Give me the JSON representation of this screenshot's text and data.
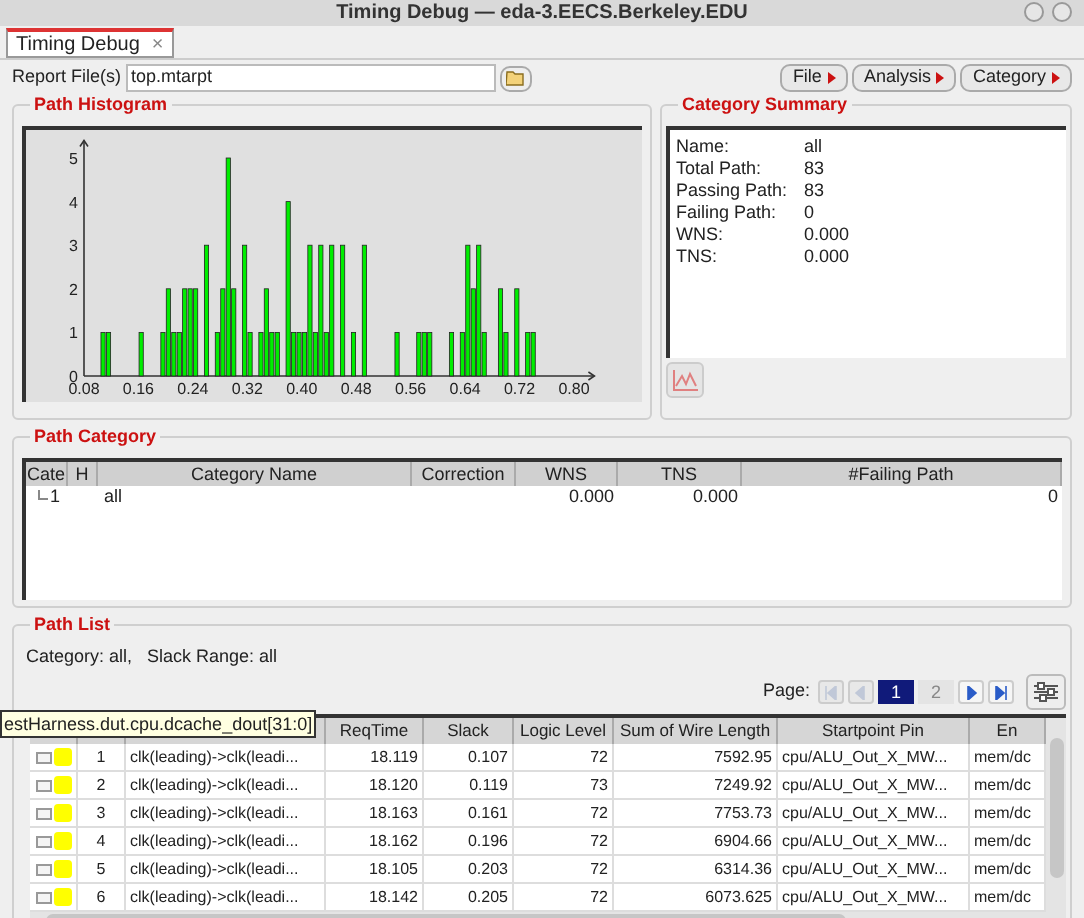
{
  "window": {
    "title": "Timing Debug — eda-3.EECS.Berkeley.EDU"
  },
  "tabs": [
    {
      "label": "Timing Debug",
      "selected": true,
      "close": "×"
    }
  ],
  "report_file": {
    "label": "Report File(s)",
    "value": "top.mtarpt"
  },
  "menu_buttons": [
    "File",
    "Analysis",
    "Category"
  ],
  "path_histogram": {
    "title": "Path Histogram",
    "chart_data": {
      "type": "bar",
      "x": [
        0.108,
        0.116,
        0.164,
        0.196,
        0.204,
        0.212,
        0.22,
        0.228,
        0.236,
        0.244,
        0.26,
        0.276,
        0.284,
        0.292,
        0.3,
        0.316,
        0.324,
        0.34,
        0.348,
        0.356,
        0.364,
        0.38,
        0.388,
        0.396,
        0.404,
        0.412,
        0.42,
        0.428,
        0.436,
        0.444,
        0.46,
        0.476,
        0.492,
        0.54,
        0.572,
        0.58,
        0.588,
        0.62,
        0.636,
        0.644,
        0.652,
        0.66,
        0.668,
        0.692,
        0.7,
        0.716,
        0.732,
        0.74
      ],
      "values": [
        1,
        1,
        1,
        1,
        2,
        1,
        1,
        2,
        2,
        2,
        3,
        1,
        2,
        5,
        2,
        3,
        1,
        1,
        2,
        1,
        1,
        4,
        1,
        1,
        1,
        3,
        1,
        3,
        1,
        3,
        3,
        1,
        3,
        1,
        1,
        1,
        1,
        1,
        1,
        3,
        2,
        3,
        1,
        2,
        1,
        2,
        1,
        1
      ],
      "xlim": [
        0.08,
        0.83
      ],
      "ylim": [
        0,
        5.4
      ],
      "xticks": [
        {
          "value": 0.08,
          "label": "0.08"
        },
        {
          "value": 0.16,
          "label": "0.16"
        },
        {
          "value": 0.24,
          "label": "0.24"
        },
        {
          "value": 0.32,
          "label": "0.32"
        },
        {
          "value": 0.4,
          "label": "0.40"
        },
        {
          "value": 0.48,
          "label": "0.48"
        },
        {
          "value": 0.56,
          "label": "0.56"
        },
        {
          "value": 0.64,
          "label": "0.64"
        },
        {
          "value": 0.72,
          "label": "0.72"
        },
        {
          "value": 0.8,
          "label": "0.80"
        }
      ],
      "yticks": [
        0,
        1,
        2,
        3,
        4,
        5
      ]
    }
  },
  "category_summary": {
    "title": "Category Summary",
    "fields": [
      {
        "label": "Name:",
        "value": "all"
      },
      {
        "label": "Total Path:",
        "value": "83"
      },
      {
        "label": "Passing Path:",
        "value": "83"
      },
      {
        "label": "Failing Path:",
        "value": "0"
      },
      {
        "label": "WNS:",
        "value": "0.000"
      },
      {
        "label": "TNS:",
        "value": "0.000"
      }
    ]
  },
  "path_category": {
    "title": "Path Category",
    "columns": [
      "Cate",
      "H",
      "Category Name",
      "Correction",
      "WNS",
      "TNS",
      "#Failing Path"
    ],
    "rows": [
      {
        "cells": [
          "1",
          null,
          "all",
          null,
          "0.000",
          "0.000",
          "0"
        ]
      }
    ]
  },
  "path_list": {
    "title": "Path List",
    "filter": "Category: all,   Slack Range: all",
    "pager": {
      "label": "Page:",
      "nav": [
        {
          "kind": "first",
          "disabled": true
        },
        {
          "kind": "prev",
          "disabled": true
        },
        {
          "kind": "next",
          "disabled": false
        },
        {
          "kind": "last",
          "disabled": false
        }
      ],
      "pages": [
        {
          "label": "1",
          "selected": true
        },
        {
          "label": "2",
          "selected": false
        }
      ]
    },
    "tooltip": "estHarness.dut.cpu.dcache_dout[31:0]",
    "columns": [
      null,
      null,
      "ReqTime",
      "Slack",
      "Logic Level",
      "Sum of Wire Length",
      "Startpoint Pin",
      "En"
    ],
    "rows": [
      {
        "checked": false,
        "color": "#ffff00",
        "cells": [
          "1",
          "clk(leading)->clk(leadi...",
          "18.119",
          "0.107",
          "72",
          "7592.95",
          "cpu/ALU_Out_X_MW...",
          "mem/dc"
        ]
      },
      {
        "checked": false,
        "color": "#ffff00",
        "cells": [
          "2",
          "clk(leading)->clk(leadi...",
          "18.120",
          "0.119",
          "73",
          "7249.92",
          "cpu/ALU_Out_X_MW...",
          "mem/dc"
        ]
      },
      {
        "checked": false,
        "color": "#ffff00",
        "cells": [
          "3",
          "clk(leading)->clk(leadi...",
          "18.163",
          "0.161",
          "72",
          "7753.73",
          "cpu/ALU_Out_X_MW...",
          "mem/dc"
        ]
      },
      {
        "checked": false,
        "color": "#ffff00",
        "cells": [
          "4",
          "clk(leading)->clk(leadi...",
          "18.162",
          "0.196",
          "72",
          "6904.66",
          "cpu/ALU_Out_X_MW...",
          "mem/dc"
        ]
      },
      {
        "checked": false,
        "color": "#ffff00",
        "cells": [
          "5",
          "clk(leading)->clk(leadi...",
          "18.105",
          "0.203",
          "72",
          "6314.36",
          "cpu/ALU_Out_X_MW...",
          "mem/dc"
        ]
      },
      {
        "checked": false,
        "color": "#ffff00",
        "cells": [
          "6",
          "clk(leading)->clk(leadi...",
          "18.142",
          "0.205",
          "72",
          "6073.625",
          "cpu/ALU_Out_X_MW...",
          "mem/dc"
        ]
      }
    ]
  }
}
